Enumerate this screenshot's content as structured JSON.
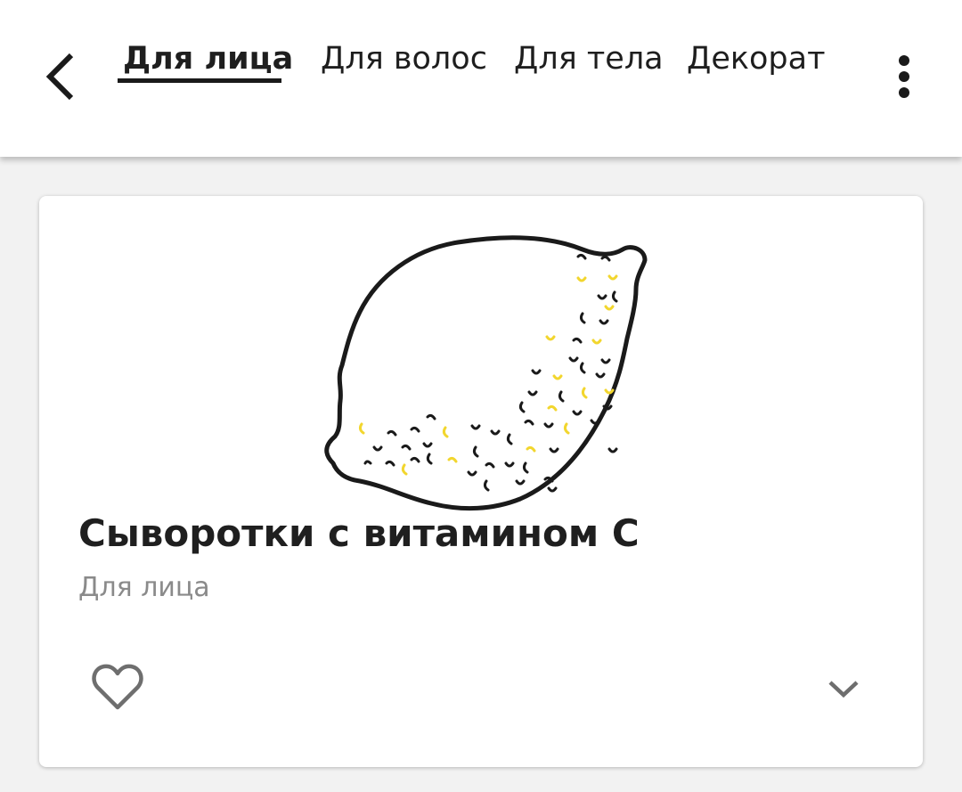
{
  "tabs": [
    {
      "label": "Для лица",
      "active": true
    },
    {
      "label": "Для волос",
      "active": false
    },
    {
      "label": "Для тела",
      "active": false
    },
    {
      "label": "Декорати",
      "active": false
    }
  ],
  "icons": {
    "back": "chevron-left-icon",
    "more": "more-vertical-icon",
    "favorite": "heart-outline-icon",
    "expand": "chevron-down-icon"
  },
  "card": {
    "title": "Сыворотки с витамином С",
    "subtitle": "Для лица",
    "image": "lemon-illustration"
  },
  "colors": {
    "accent_yellow": "#f2d62e",
    "text_primary": "#1f1f1f",
    "text_secondary": "#8a8a8a",
    "background": "#f2f2f2"
  }
}
